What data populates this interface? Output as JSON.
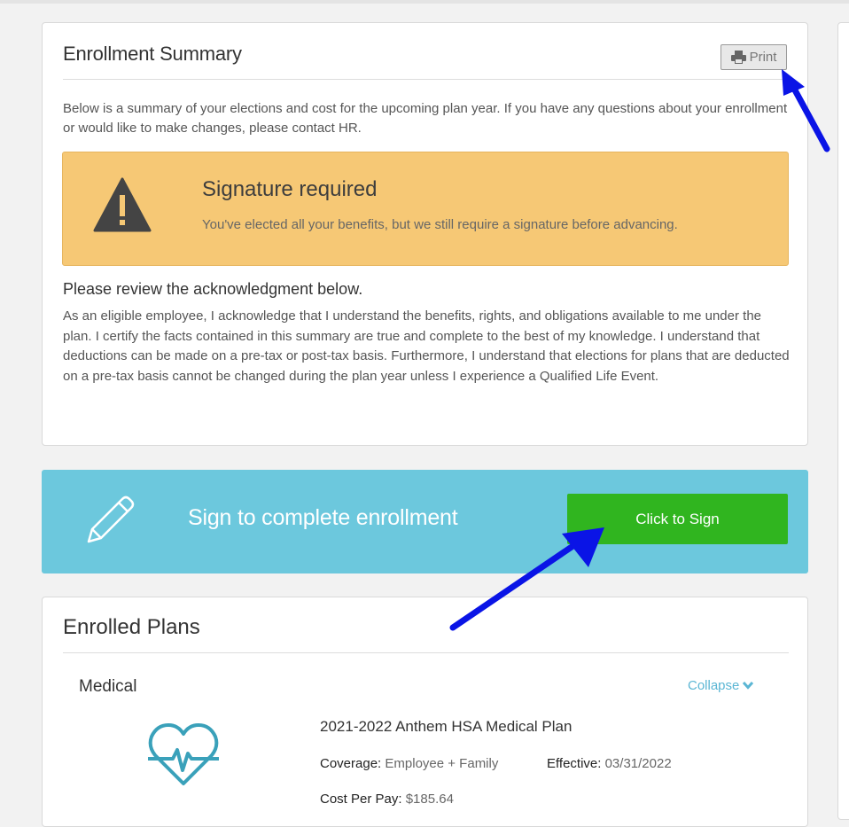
{
  "summary": {
    "title": "Enrollment Summary",
    "print_label": "Print",
    "intro": "Below is a summary of your elections and cost for the upcoming plan year. If you have any questions about your enrollment or would like to make changes, please contact HR."
  },
  "alert": {
    "title": "Signature required",
    "message": "You've elected all your benefits, but we still require a signature before advancing."
  },
  "acknowledgment": {
    "heading": "Please review the acknowledgment below.",
    "text": "As an eligible employee, I acknowledge that I understand the benefits, rights, and obligations available to me under the plan.  I certify the facts contained in this summary are true and complete to the best of my knowledge.  I understand that deductions can be made on a pre-tax or post-tax basis.   Furthermore, I understand that elections for plans that are deducted on a pre-tax basis cannot be changed during the plan year unless I experience a Qualified Life Event."
  },
  "sign_banner": {
    "text": "Sign to complete enrollment",
    "button_label": "Click to Sign"
  },
  "plans": {
    "title": "Enrolled Plans",
    "category": "Medical",
    "collapse_label": "Collapse",
    "plan_name": "2021-2022 Anthem HSA Medical Plan",
    "coverage_label": "Coverage:",
    "coverage_value": "Employee + Family",
    "effective_label": "Effective:",
    "effective_value": "03/31/2022",
    "cost_label": "Cost Per Pay:",
    "cost_value": "$185.64"
  },
  "colors": {
    "alert_bg": "#f6c875",
    "banner_bg": "#6cc8dd",
    "sign_button": "#30b51f",
    "link": "#5bb6d4",
    "annotation_arrow": "#0a14e6"
  },
  "icons": [
    "print-icon",
    "warning-icon",
    "pencil-icon",
    "chevron-down-icon",
    "heart-pulse-icon",
    "annotation-arrow"
  ]
}
